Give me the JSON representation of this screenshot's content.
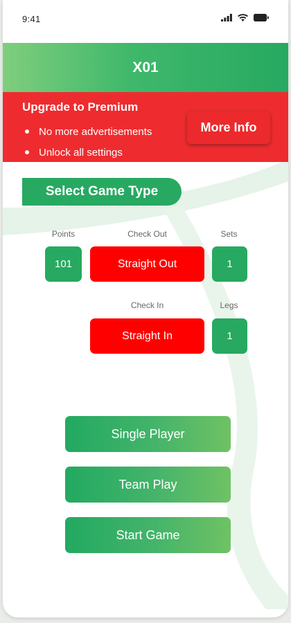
{
  "status_bar": {
    "time": "9:41",
    "icons": [
      "signal-icon",
      "wifi-icon",
      "battery-icon"
    ]
  },
  "header": {
    "title": "X01"
  },
  "premium": {
    "title": "Upgrade to Premium",
    "features": [
      "No more advertisements",
      "Unlock all settings"
    ],
    "more_info_label": "More Info"
  },
  "game_type": {
    "section_label": "Select Game Type",
    "points": {
      "label": "Points",
      "value": "101"
    },
    "check_out": {
      "label": "Check Out",
      "value": "Straight Out"
    },
    "sets": {
      "label": "Sets",
      "value": "1"
    },
    "check_in": {
      "label": "Check In",
      "value": "Straight In"
    },
    "legs": {
      "label": "Legs",
      "value": "1"
    }
  },
  "actions": {
    "single_player": "Single Player",
    "team_play": "Team Play",
    "start_game": "Start Game"
  },
  "colors": {
    "green": "#27a961",
    "red": "#ff0000",
    "premium_red": "#ee2c2f"
  }
}
